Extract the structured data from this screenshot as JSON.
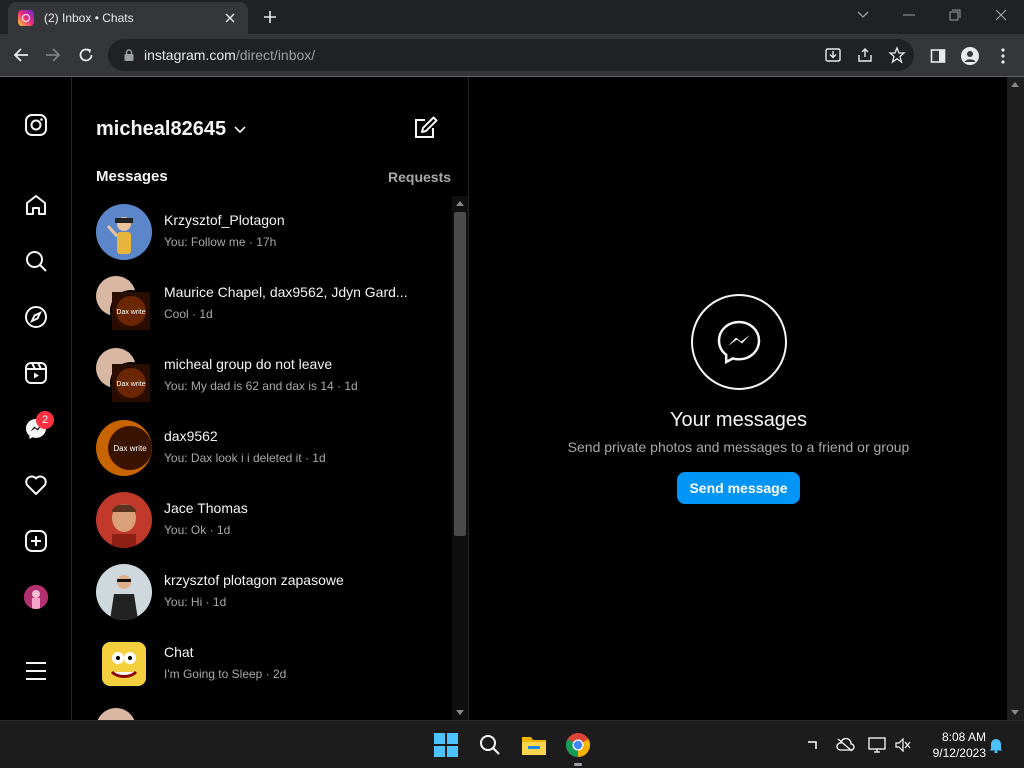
{
  "browser": {
    "tab_title": "(2) Inbox • Chats",
    "url_host": "instagram.com",
    "url_path": "/direct/inbox/"
  },
  "inbox": {
    "username": "micheal82645",
    "tab_messages": "Messages",
    "tab_requests": "Requests",
    "notification_count": "2",
    "threads": [
      {
        "name": "Krzysztof_Plotagon",
        "preview": "You: Follow me · 17h",
        "avatar_color": "#5b86c9"
      },
      {
        "name": "Maurice Chapel, dax9562, Jdyn Gard...",
        "preview": "Cool · 1d",
        "avatar_color": "#7a2e00"
      },
      {
        "name": "micheal group do not leave",
        "preview": "You: My dad is 62 and dax is 14 · 1d",
        "avatar_color": "#7a2e00"
      },
      {
        "name": "dax9562",
        "preview": "You: Dax look i i deleted it · 1d",
        "avatar_color": "#c86400"
      },
      {
        "name": "Jace Thomas",
        "preview": "You: Ok · 1d",
        "avatar_color": "#c0392b"
      },
      {
        "name": "krzysztof plotagon zapasowe",
        "preview": "You: Hi · 1d",
        "avatar_color": "#cfd8dc"
      },
      {
        "name": "Chat",
        "preview": "I'm Going to Sleep · 2d",
        "avatar_color": "#f4d03f"
      }
    ],
    "avatar_text": "Dax write"
  },
  "main": {
    "title": "Your messages",
    "subtitle": "Send private photos and messages to a friend or group",
    "button": "Send message"
  },
  "taskbar": {
    "time": "8:08 AM",
    "date": "9/12/2023"
  },
  "colors": {
    "accent": "#0095f6",
    "badge": "#ff3040",
    "background": "#000000"
  }
}
